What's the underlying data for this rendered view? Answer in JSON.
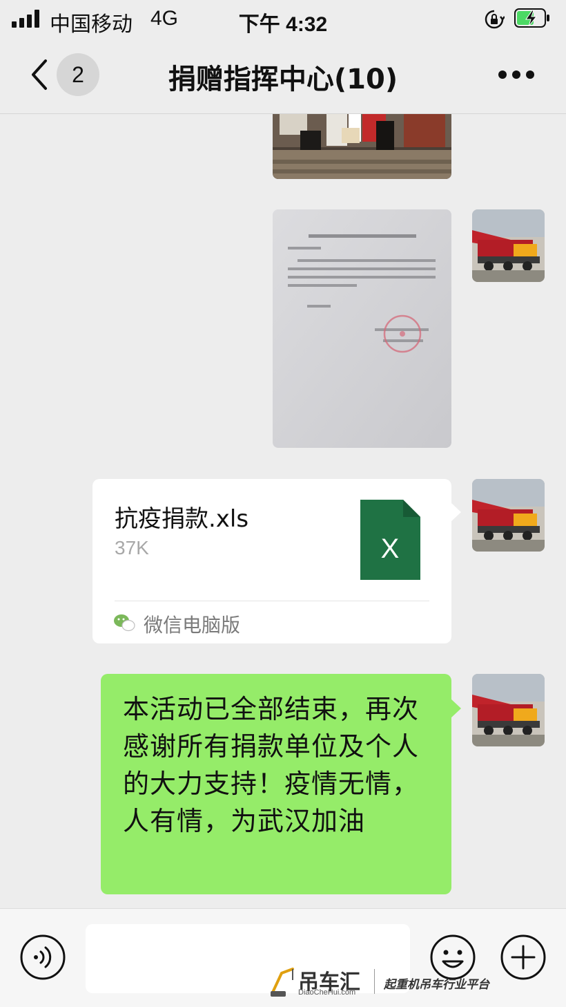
{
  "status_bar": {
    "carrier": "中国移动",
    "network": "4G",
    "time": "下午 4:32",
    "battery_icon": "battery-charging-icon",
    "lock_icon": "orientation-lock-icon"
  },
  "nav": {
    "back_icon": "chevron-left-icon",
    "unread_count": "2",
    "title": "捐赠指挥中心(10)",
    "more_icon": "more-dots-icon"
  },
  "messages": {
    "file": {
      "name": "抗疫捐款.xls",
      "size": "37K",
      "icon": "excel-file-icon",
      "icon_letter": "X",
      "source": "微信电脑版"
    },
    "text": "本活动已全部结束，再次感谢所有捐款单位及个人的大力支持！疫情无情，人有情，为武汉加油",
    "document_stamp_text": "武汉市黄陂区长轩岭街韩畈村接受捐赠证明"
  },
  "input_bar": {
    "voice_icon": "voice-icon",
    "emoji_icon": "smile-icon",
    "plus_icon": "plus-circle-icon",
    "placeholder": ""
  },
  "watermark": {
    "brand": "吊车汇",
    "domain": "DiaoCheHui.com",
    "slogan": "起重机吊车行业平台"
  },
  "colors": {
    "background": "#ededed",
    "sent_bubble": "#95ec69",
    "excel_green": "#1f7244",
    "battery_green": "#4cd964"
  }
}
